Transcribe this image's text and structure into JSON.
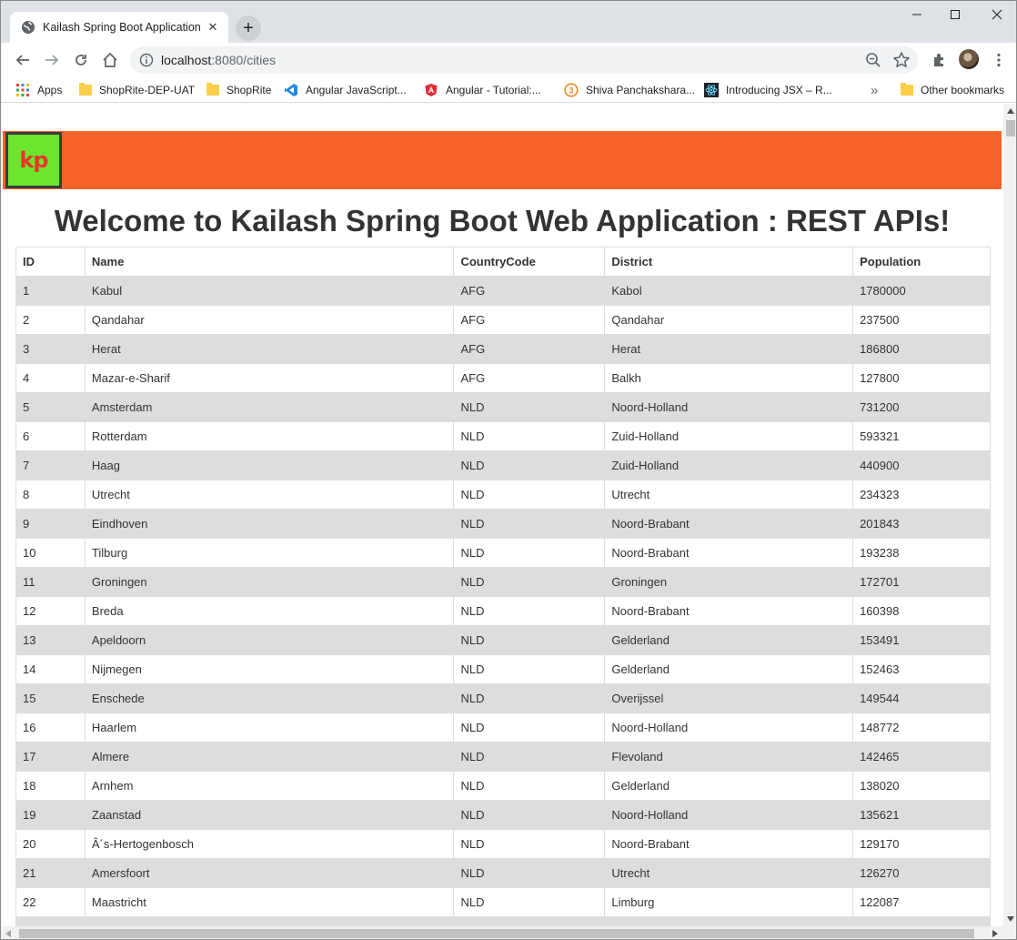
{
  "browser": {
    "tab_title": "Kailash Spring Boot Application",
    "url_host": "localhost",
    "url_rest": ":8080/cities",
    "new_tab_label": "+",
    "bookmarks": [
      {
        "label": "Apps",
        "icon": "apps-grid-icon"
      },
      {
        "label": "ShopRite-DEP-UAT",
        "icon": "folder-icon"
      },
      {
        "label": "ShopRite",
        "icon": "folder-icon"
      },
      {
        "label": "Angular JavaScript...",
        "icon": "vscode-icon"
      },
      {
        "label": "Angular - Tutorial:...",
        "icon": "angular-icon"
      },
      {
        "label": "Shiva Panchakshara...",
        "icon": "circled-3-icon"
      },
      {
        "label": "Introducing JSX – R...",
        "icon": "react-icon"
      },
      {
        "label": "Other bookmarks",
        "icon": "folder-icon"
      }
    ],
    "overflow_label": "»"
  },
  "page": {
    "logo_text": "kp",
    "heading": "Welcome to Kailash Spring Boot Web Application : REST APIs!",
    "colors": {
      "header": "#f7632a",
      "logo_bg": "#6de52e",
      "logo_text": "#e8372b",
      "row_stripe": "#dddddd"
    }
  },
  "table": {
    "columns": [
      "ID",
      "Name",
      "CountryCode",
      "District",
      "Population"
    ],
    "rows": [
      [
        "1",
        "Kabul",
        "AFG",
        "Kabol",
        "1780000"
      ],
      [
        "2",
        "Qandahar",
        "AFG",
        "Qandahar",
        "237500"
      ],
      [
        "3",
        "Herat",
        "AFG",
        "Herat",
        "186800"
      ],
      [
        "4",
        "Mazar-e-Sharif",
        "AFG",
        "Balkh",
        "127800"
      ],
      [
        "5",
        "Amsterdam",
        "NLD",
        "Noord-Holland",
        "731200"
      ],
      [
        "6",
        "Rotterdam",
        "NLD",
        "Zuid-Holland",
        "593321"
      ],
      [
        "7",
        "Haag",
        "NLD",
        "Zuid-Holland",
        "440900"
      ],
      [
        "8",
        "Utrecht",
        "NLD",
        "Utrecht",
        "234323"
      ],
      [
        "9",
        "Eindhoven",
        "NLD",
        "Noord-Brabant",
        "201843"
      ],
      [
        "10",
        "Tilburg",
        "NLD",
        "Noord-Brabant",
        "193238"
      ],
      [
        "11",
        "Groningen",
        "NLD",
        "Groningen",
        "172701"
      ],
      [
        "12",
        "Breda",
        "NLD",
        "Noord-Brabant",
        "160398"
      ],
      [
        "13",
        "Apeldoorn",
        "NLD",
        "Gelderland",
        "153491"
      ],
      [
        "14",
        "Nijmegen",
        "NLD",
        "Gelderland",
        "152463"
      ],
      [
        "15",
        "Enschede",
        "NLD",
        "Overijssel",
        "149544"
      ],
      [
        "16",
        "Haarlem",
        "NLD",
        "Noord-Holland",
        "148772"
      ],
      [
        "17",
        "Almere",
        "NLD",
        "Flevoland",
        "142465"
      ],
      [
        "18",
        "Arnhem",
        "NLD",
        "Gelderland",
        "138020"
      ],
      [
        "19",
        "Zaanstad",
        "NLD",
        "Noord-Holland",
        "135621"
      ],
      [
        "20",
        "Â´s-Hertogenbosch",
        "NLD",
        "Noord-Brabant",
        "129170"
      ],
      [
        "21",
        "Amersfoort",
        "NLD",
        "Utrecht",
        "126270"
      ],
      [
        "22",
        "Maastricht",
        "NLD",
        "Limburg",
        "122087"
      ],
      [
        "",
        "",
        "",
        "",
        ""
      ]
    ]
  }
}
